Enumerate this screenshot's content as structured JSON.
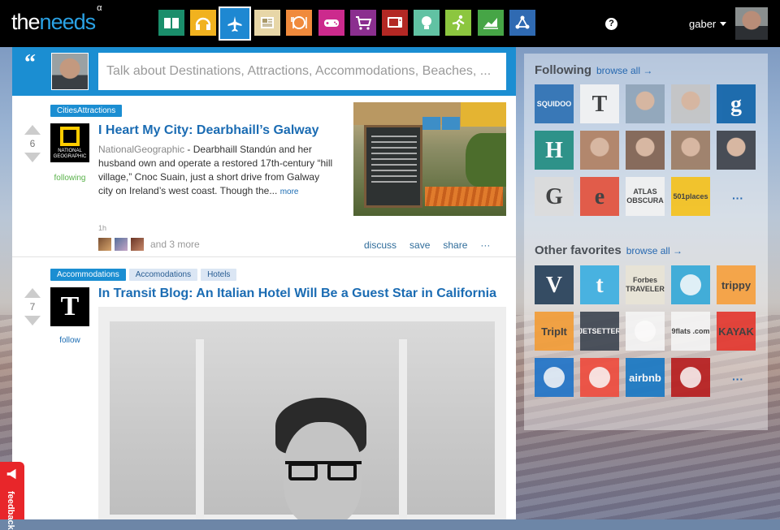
{
  "app": {
    "logo_part1": "the",
    "logo_part2": "needs",
    "logo_version": "α",
    "help_label": "?",
    "username": "gaber",
    "feedback_label": "feedback"
  },
  "categories": [
    {
      "name": "books",
      "icon": "book-icon",
      "color": "#1a8e6b"
    },
    {
      "name": "music",
      "icon": "headphones-icon",
      "color": "#f1b21f"
    },
    {
      "name": "travel",
      "icon": "airplane-icon",
      "color": "#1e88d2",
      "active": true
    },
    {
      "name": "news",
      "icon": "newspaper-icon",
      "color": "#e7d6a7"
    },
    {
      "name": "food",
      "icon": "plate-icon",
      "color": "#f08a3c"
    },
    {
      "name": "games",
      "icon": "gamepad-icon",
      "color": "#cc2a8d"
    },
    {
      "name": "shopping",
      "icon": "cart-icon",
      "color": "#8b2f8f"
    },
    {
      "name": "tv",
      "icon": "tv-icon",
      "color": "#b32824"
    },
    {
      "name": "ideas",
      "icon": "lightbulb-icon",
      "color": "#61c2a3"
    },
    {
      "name": "sports",
      "icon": "runner-icon",
      "color": "#8cc63f"
    },
    {
      "name": "finance",
      "icon": "chart-icon",
      "color": "#46a546"
    },
    {
      "name": "science",
      "icon": "molecule-icon",
      "color": "#2f6ab2"
    }
  ],
  "composer": {
    "placeholder": "Talk about Destinations, Attractions, Accommodations, Beaches, ..."
  },
  "posts": [
    {
      "tags": [
        "CitiesAttractions"
      ],
      "votes": "6",
      "source_logo_text": "NATIONAL GEOGRAPHIC",
      "follow_label": "following",
      "title": "I Heart My City: Dearbhaill’s Galway",
      "source": "NationalGeographic",
      "excerpt": " - Dearbhaill Standún  and her husband own and operate a restored 17th-century “hill village,”  Cnoc Suain, just a short drive from Galway city on Ireland’s west coast. Though the...",
      "more_label": "more",
      "time": "1h",
      "others": "and 3 more",
      "actions": [
        "discuss",
        "save",
        "share",
        "···"
      ]
    },
    {
      "tags": [
        "Accommodations",
        "Accomodations",
        "Hotels"
      ],
      "votes": "7",
      "source_logo_text": "T",
      "follow_label": "follow",
      "title": "In Transit Blog: An Italian Hotel Will Be a Guest Star in California"
    }
  ],
  "following": {
    "title": "Following",
    "browse_all": "browse all →",
    "more_dots": "···",
    "tiles": [
      {
        "name": "squidoo",
        "text": "SQUIDOO",
        "bg": "#2b6fb3"
      },
      {
        "name": "telegraph",
        "text": "T",
        "bg": "#f4f4f4"
      },
      {
        "name": "person-1",
        "text": "",
        "bg": "#8fa4b8"
      },
      {
        "name": "person-2",
        "text": "",
        "bg": "#c5c5c5"
      },
      {
        "name": "guardian",
        "text": "g",
        "bg": "#0d62a8"
      },
      {
        "name": "huffington",
        "text": "H",
        "bg": "#1e8b80"
      },
      {
        "name": "person-3",
        "text": "",
        "bg": "#b07f61"
      },
      {
        "name": "person-4",
        "text": "",
        "bg": "#80604e"
      },
      {
        "name": "person-5",
        "text": "",
        "bg": "#9c7b62"
      },
      {
        "name": "person-6",
        "text": "",
        "bg": "#3b3f47"
      },
      {
        "name": "gizmodo",
        "text": "G",
        "bg": "#dcdcdc"
      },
      {
        "name": "engadget",
        "text": "e",
        "bg": "#e34f3a"
      },
      {
        "name": "atlas-obscura",
        "text": "ATLAS OBSCURA",
        "bg": "#f2f2f2"
      },
      {
        "name": "501places",
        "text": "501places",
        "bg": "#f5c11a"
      }
    ]
  },
  "favorites": {
    "title": "Other favorites",
    "browse_all": "browse all →",
    "more_dots": "···",
    "tiles": [
      {
        "name": "viator",
        "text": "V",
        "bg": "#233d57"
      },
      {
        "name": "tumblr",
        "text": "t",
        "bg": "#39aee1"
      },
      {
        "name": "forbes-traveler",
        "text": "Forbes TRAVELER",
        "bg": "#e9e4d6"
      },
      {
        "name": "kayak-arrow",
        "text": "",
        "bg": "#32a8d8"
      },
      {
        "name": "trippy",
        "text": "trippy",
        "bg": "#f79f3b"
      },
      {
        "name": "tripit",
        "text": "TripIt",
        "bg": "#f39c35"
      },
      {
        "name": "jetsetter",
        "text": "JETSETTER",
        "bg": "#3c4450"
      },
      {
        "name": "balloon",
        "text": "",
        "bg": "#f5f5f5"
      },
      {
        "name": "9flats",
        "text": "9flats .com",
        "bg": "#f5f5f5"
      },
      {
        "name": "kayak",
        "text": "KAYAK",
        "bg": "#e4352c"
      },
      {
        "name": "plane",
        "text": "",
        "bg": "#1e73c9"
      },
      {
        "name": "airbnb-ribbon",
        "text": "",
        "bg": "#ef4a3c"
      },
      {
        "name": "airbnb",
        "text": "airbnb",
        "bg": "#1577c4"
      },
      {
        "name": "yelp",
        "text": "",
        "bg": "#b71b1c"
      }
    ]
  }
}
